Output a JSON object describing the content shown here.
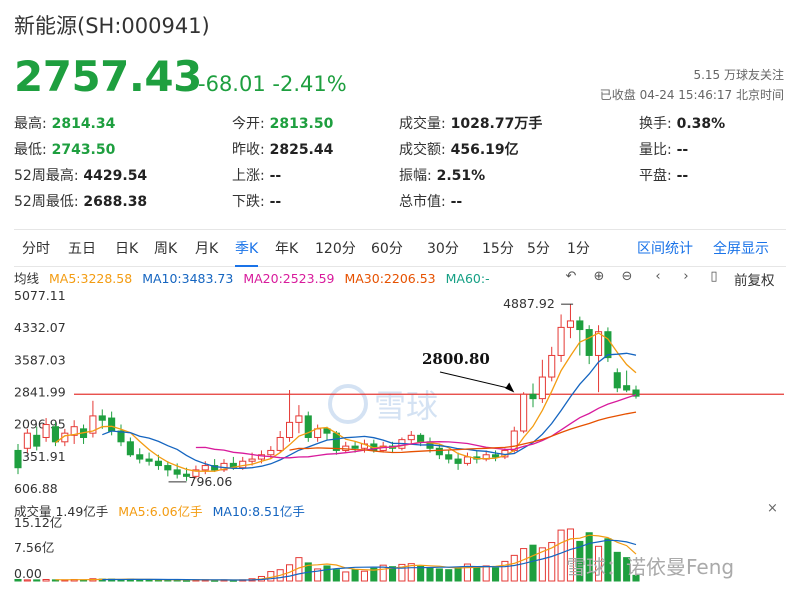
{
  "header": {
    "title": "新能源(SH:000941)",
    "price": "2757.43",
    "change": "-68.01",
    "change_pct": "-2.41%",
    "followers": "5.15 万球友关注",
    "status": "已收盘 04-24 15:46:17 北京时间"
  },
  "stats": [
    {
      "label": "最高:",
      "value": "2814.34",
      "green": true
    },
    {
      "label": "今开:",
      "value": "2813.50",
      "green": true
    },
    {
      "label": "成交量:",
      "value": "1028.77万手",
      "green": false
    },
    {
      "label": "换手:",
      "value": "0.38%",
      "green": false
    },
    {
      "label": "最低:",
      "value": "2743.50",
      "green": true
    },
    {
      "label": "昨收:",
      "value": "2825.44",
      "green": false
    },
    {
      "label": "成交额:",
      "value": "456.19亿",
      "green": false
    },
    {
      "label": "量比:",
      "value": "--",
      "green": false
    },
    {
      "label": "52周最高:",
      "value": "4429.54",
      "green": false
    },
    {
      "label": "上涨:",
      "value": "--",
      "green": false
    },
    {
      "label": "振幅:",
      "value": "2.51%",
      "green": false
    },
    {
      "label": "平盘:",
      "value": "--",
      "green": false
    },
    {
      "label": "52周最低:",
      "value": "2688.38",
      "green": false
    },
    {
      "label": "下跌:",
      "value": "--",
      "green": false
    },
    {
      "label": "总市值:",
      "value": "--",
      "green": false
    }
  ],
  "tabs": [
    "分时",
    "五日",
    "日K",
    "周K",
    "月K",
    "季K",
    "年K",
    "120分",
    "60分",
    "30分",
    "15分",
    "5分",
    "1分"
  ],
  "active_tab": "季K",
  "tab_links": [
    "区间统计",
    "全屏显示"
  ],
  "ma": {
    "label": "均线",
    "ma5": "MA5:3228.58",
    "ma10": "MA10:3483.73",
    "ma20": "MA20:2523.59",
    "ma30": "MA30:2206.53",
    "ma60": "MA60:-"
  },
  "controls": {
    "adjust_label": "前复权"
  },
  "volume": {
    "label": "成交量 1.49亿手",
    "ma5": "MA5:6.06亿手",
    "ma10": "MA10:8.51亿手"
  },
  "colors": {
    "up": "#e53935",
    "down": "#1e9f3f",
    "ma5": "#f39c12",
    "ma10": "#1565c0",
    "ma20": "#d81b9c",
    "ma30": "#e65100",
    "ma60": "#16a085",
    "link": "#1a73e8",
    "ref": "#e53935"
  },
  "watermark": {
    "logo": "雪球",
    "credit": "雪球：诺依曼Feng"
  },
  "chart_data": {
    "type": "candlestick",
    "y_ticks": [
      "5077.11",
      "4332.07",
      "3587.03",
      "2841.99",
      "2096.95",
      "1351.91",
      "606.88"
    ],
    "ylim": [
      606.88,
      5077.11
    ],
    "reference_line": 2800.8,
    "annotations": [
      {
        "text": "2800.80",
        "x_index": 53,
        "y": 2841.99
      },
      {
        "text": "4887.92",
        "x_index": 58,
        "y": 4887.92
      },
      {
        "text": "796.06",
        "x_index": 18,
        "y": 796.06
      }
    ],
    "volume_ticks": [
      "15.12亿",
      "7.56亿",
      "0.00"
    ],
    "volume_ylim": [
      0,
      15.12
    ],
    "candles": [
      {
        "o": 1500,
        "c": 1100,
        "h": 1650,
        "l": 950
      },
      {
        "o": 1550,
        "c": 1900,
        "h": 2000,
        "l": 1450
      },
      {
        "o": 1850,
        "c": 1600,
        "h": 2050,
        "l": 1500
      },
      {
        "o": 1800,
        "c": 2100,
        "h": 2250,
        "l": 1700
      },
      {
        "o": 2050,
        "c": 1700,
        "h": 2150,
        "l": 1600
      },
      {
        "o": 1700,
        "c": 1900,
        "h": 2000,
        "l": 1600
      },
      {
        "o": 1850,
        "c": 2050,
        "h": 2200,
        "l": 1650
      },
      {
        "o": 2000,
        "c": 1800,
        "h": 2100,
        "l": 1650
      },
      {
        "o": 1900,
        "c": 2300,
        "h": 2650,
        "l": 1800
      },
      {
        "o": 2300,
        "c": 2200,
        "h": 2450,
        "l": 2000
      },
      {
        "o": 2250,
        "c": 1950,
        "h": 2400,
        "l": 1850
      },
      {
        "o": 1950,
        "c": 1700,
        "h": 2100,
        "l": 1600
      },
      {
        "o": 1700,
        "c": 1400,
        "h": 1800,
        "l": 1350
      },
      {
        "o": 1400,
        "c": 1300,
        "h": 1550,
        "l": 1200
      },
      {
        "o": 1300,
        "c": 1250,
        "h": 1450,
        "l": 1150
      },
      {
        "o": 1250,
        "c": 1150,
        "h": 1400,
        "l": 1050
      },
      {
        "o": 1150,
        "c": 1050,
        "h": 1250,
        "l": 900
      },
      {
        "o": 1050,
        "c": 950,
        "h": 1200,
        "l": 850
      },
      {
        "o": 950,
        "c": 900,
        "h": 1100,
        "l": 796
      },
      {
        "o": 900,
        "c": 1050,
        "h": 1150,
        "l": 850
      },
      {
        "o": 1050,
        "c": 1150,
        "h": 1250,
        "l": 950
      },
      {
        "o": 1150,
        "c": 1050,
        "h": 1300,
        "l": 1000
      },
      {
        "o": 1050,
        "c": 1200,
        "h": 1300,
        "l": 1000
      },
      {
        "o": 1200,
        "c": 1100,
        "h": 1350,
        "l": 1050
      },
      {
        "o": 1100,
        "c": 1250,
        "h": 1350,
        "l": 1050
      },
      {
        "o": 1250,
        "c": 1300,
        "h": 1450,
        "l": 1150
      },
      {
        "o": 1300,
        "c": 1400,
        "h": 1500,
        "l": 1200
      },
      {
        "o": 1400,
        "c": 1500,
        "h": 1600,
        "l": 1300
      },
      {
        "o": 1500,
        "c": 1800,
        "h": 1950,
        "l": 1450
      },
      {
        "o": 1800,
        "c": 2150,
        "h": 2900,
        "l": 1700
      },
      {
        "o": 2150,
        "c": 2300,
        "h": 2550,
        "l": 1900
      },
      {
        "o": 2300,
        "c": 1800,
        "h": 2400,
        "l": 1700
      },
      {
        "o": 1800,
        "c": 2000,
        "h": 2100,
        "l": 1700
      },
      {
        "o": 2000,
        "c": 1900,
        "h": 2050,
        "l": 1750
      },
      {
        "o": 1900,
        "c": 1500,
        "h": 1950,
        "l": 1400
      },
      {
        "o": 1500,
        "c": 1600,
        "h": 1700,
        "l": 1450
      },
      {
        "o": 1600,
        "c": 1550,
        "h": 1700,
        "l": 1450
      },
      {
        "o": 1550,
        "c": 1650,
        "h": 1750,
        "l": 1450
      },
      {
        "o": 1650,
        "c": 1500,
        "h": 1750,
        "l": 1450
      },
      {
        "o": 1500,
        "c": 1600,
        "h": 1700,
        "l": 1450
      },
      {
        "o": 1600,
        "c": 1550,
        "h": 1700,
        "l": 1450
      },
      {
        "o": 1550,
        "c": 1750,
        "h": 1800,
        "l": 1500
      },
      {
        "o": 1750,
        "c": 1850,
        "h": 1950,
        "l": 1650
      },
      {
        "o": 1850,
        "c": 1700,
        "h": 1900,
        "l": 1600
      },
      {
        "o": 1700,
        "c": 1550,
        "h": 1800,
        "l": 1450
      },
      {
        "o": 1550,
        "c": 1400,
        "h": 1650,
        "l": 1300
      },
      {
        "o": 1400,
        "c": 1300,
        "h": 1500,
        "l": 1200
      },
      {
        "o": 1300,
        "c": 1200,
        "h": 1450,
        "l": 1050
      },
      {
        "o": 1200,
        "c": 1350,
        "h": 1450,
        "l": 1150
      },
      {
        "o": 1350,
        "c": 1300,
        "h": 1500,
        "l": 1200
      },
      {
        "o": 1300,
        "c": 1400,
        "h": 1500,
        "l": 1250
      },
      {
        "o": 1400,
        "c": 1350,
        "h": 1500,
        "l": 1250
      },
      {
        "o": 1350,
        "c": 1500,
        "h": 1550,
        "l": 1300
      },
      {
        "o": 1500,
        "c": 1950,
        "h": 2050,
        "l": 1450
      },
      {
        "o": 1950,
        "c": 2800,
        "h": 2850,
        "l": 1900
      },
      {
        "o": 2800,
        "c": 2700,
        "h": 3050,
        "l": 2500
      },
      {
        "o": 2700,
        "c": 3200,
        "h": 3600,
        "l": 2600
      },
      {
        "o": 3200,
        "c": 3700,
        "h": 3900,
        "l": 3100
      },
      {
        "o": 3700,
        "c": 4350,
        "h": 4650,
        "l": 3550
      },
      {
        "o": 4350,
        "c": 4500,
        "h": 4888,
        "l": 4100
      },
      {
        "o": 4500,
        "c": 4300,
        "h": 4600,
        "l": 3700
      },
      {
        "o": 4300,
        "c": 3700,
        "h": 4400,
        "l": 3500
      },
      {
        "o": 3700,
        "c": 4250,
        "h": 4400,
        "l": 2850
      },
      {
        "o": 4250,
        "c": 3650,
        "h": 4350,
        "l": 3550
      },
      {
        "o": 3300,
        "c": 2950,
        "h": 3400,
        "l": 2850
      },
      {
        "o": 3000,
        "c": 2900,
        "h": 3350,
        "l": 2850
      },
      {
        "o": 2900,
        "c": 2757.43,
        "h": 3000,
        "l": 2700
      }
    ],
    "volumes": [
      {
        "v": 0.4,
        "up": false
      },
      {
        "v": 0.3,
        "up": true
      },
      {
        "v": 0.3,
        "up": false
      },
      {
        "v": 0.4,
        "up": true
      },
      {
        "v": 0.3,
        "up": false
      },
      {
        "v": 0.3,
        "up": true
      },
      {
        "v": 0.4,
        "up": true
      },
      {
        "v": 0.3,
        "up": false
      },
      {
        "v": 0.6,
        "up": true
      },
      {
        "v": 0.5,
        "up": false
      },
      {
        "v": 0.5,
        "up": false
      },
      {
        "v": 0.4,
        "up": false
      },
      {
        "v": 0.5,
        "up": false
      },
      {
        "v": 0.4,
        "up": false
      },
      {
        "v": 0.3,
        "up": false
      },
      {
        "v": 0.3,
        "up": false
      },
      {
        "v": 0.3,
        "up": false
      },
      {
        "v": 0.3,
        "up": false
      },
      {
        "v": 0.2,
        "up": false
      },
      {
        "v": 0.3,
        "up": true
      },
      {
        "v": 0.3,
        "up": true
      },
      {
        "v": 0.2,
        "up": false
      },
      {
        "v": 0.3,
        "up": true
      },
      {
        "v": 0.2,
        "up": false
      },
      {
        "v": 0.3,
        "up": true
      },
      {
        "v": 0.6,
        "up": true
      },
      {
        "v": 1.2,
        "up": true
      },
      {
        "v": 2.5,
        "up": true
      },
      {
        "v": 3.0,
        "up": true
      },
      {
        "v": 4.3,
        "up": true
      },
      {
        "v": 6.2,
        "up": true
      },
      {
        "v": 4.8,
        "up": false
      },
      {
        "v": 3.2,
        "up": true
      },
      {
        "v": 4.0,
        "up": false
      },
      {
        "v": 3.0,
        "up": false
      },
      {
        "v": 2.4,
        "up": true
      },
      {
        "v": 3.0,
        "up": false
      },
      {
        "v": 2.6,
        "up": true
      },
      {
        "v": 3.4,
        "up": false
      },
      {
        "v": 4.2,
        "up": true
      },
      {
        "v": 3.8,
        "up": false
      },
      {
        "v": 4.4,
        "up": true
      },
      {
        "v": 4.6,
        "up": true
      },
      {
        "v": 3.9,
        "up": false
      },
      {
        "v": 3.5,
        "up": false
      },
      {
        "v": 3.2,
        "up": false
      },
      {
        "v": 3.0,
        "up": false
      },
      {
        "v": 3.6,
        "up": false
      },
      {
        "v": 4.5,
        "up": true
      },
      {
        "v": 3.8,
        "up": false
      },
      {
        "v": 4.0,
        "up": true
      },
      {
        "v": 3.5,
        "up": false
      },
      {
        "v": 5.2,
        "up": true
      },
      {
        "v": 6.8,
        "up": true
      },
      {
        "v": 8.6,
        "up": true
      },
      {
        "v": 9.5,
        "up": false
      },
      {
        "v": 8.8,
        "up": true
      },
      {
        "v": 10.2,
        "up": true
      },
      {
        "v": 13.5,
        "up": true
      },
      {
        "v": 13.8,
        "up": true
      },
      {
        "v": 10.5,
        "up": false
      },
      {
        "v": 12.8,
        "up": false
      },
      {
        "v": 9.2,
        "up": true
      },
      {
        "v": 11.2,
        "up": false
      },
      {
        "v": 7.6,
        "up": false
      },
      {
        "v": 6.2,
        "up": false
      },
      {
        "v": 1.5,
        "up": false
      }
    ]
  }
}
